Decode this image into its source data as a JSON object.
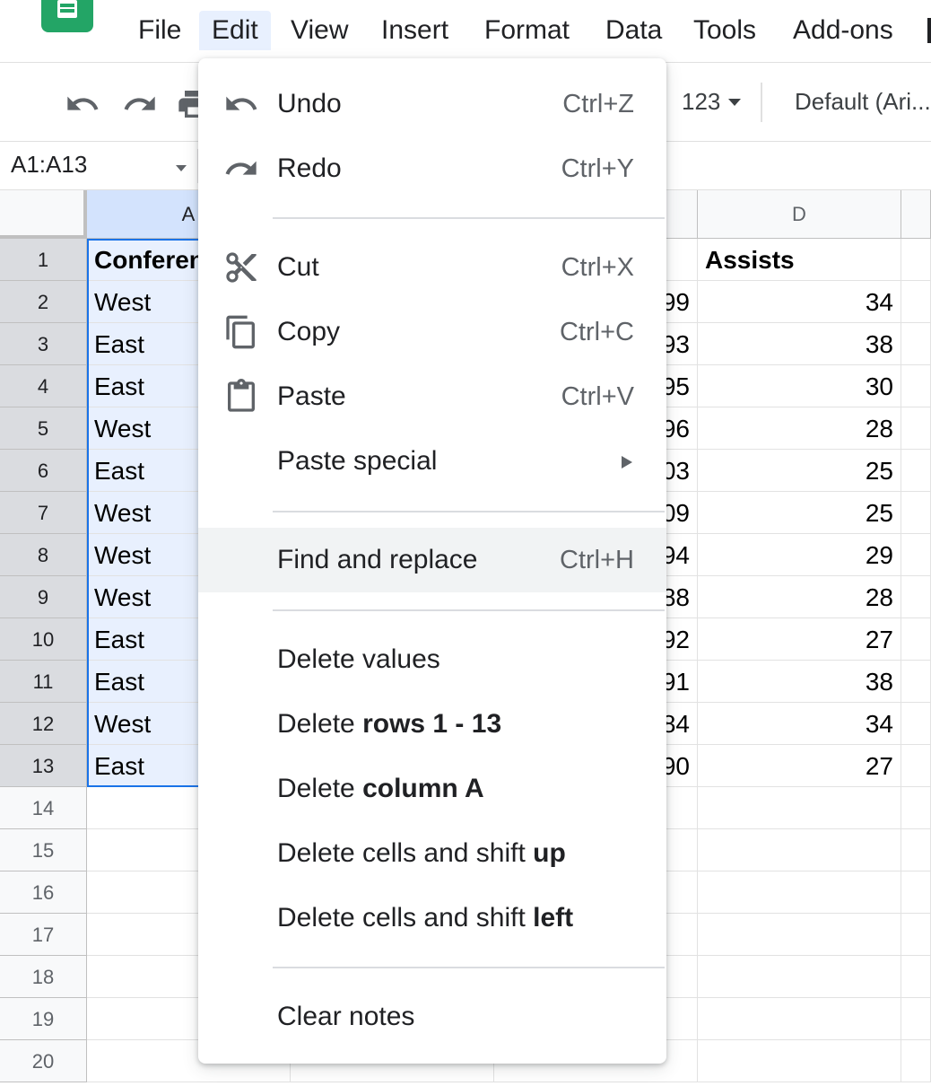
{
  "menubar": {
    "items": [
      "File",
      "Edit",
      "View",
      "Insert",
      "Format",
      "Data",
      "Tools",
      "Add-ons"
    ],
    "active": "Edit"
  },
  "toolbar": {
    "number_format": "123",
    "font": "Default (Ari..."
  },
  "namebox": {
    "value": "A1:A13"
  },
  "columns": [
    "A",
    "D"
  ],
  "rows": [
    "1",
    "2",
    "3",
    "4",
    "5",
    "6",
    "7",
    "8",
    "9",
    "10",
    "11",
    "12",
    "13",
    "14",
    "15",
    "16",
    "17",
    "18",
    "19",
    "20"
  ],
  "cells": {
    "A": [
      "Conferen",
      "West",
      "East",
      "East",
      "West",
      "East",
      "West",
      "West",
      "West",
      "East",
      "East",
      "West",
      "East"
    ],
    "C_partial": [
      "99",
      "93",
      "95",
      "96",
      "03",
      "09",
      "94",
      "88",
      "92",
      "91",
      "84",
      "90"
    ],
    "D": [
      "Assists",
      "34",
      "38",
      "30",
      "28",
      "25",
      "25",
      "29",
      "28",
      "27",
      "38",
      "34",
      "27"
    ]
  },
  "edit_menu": {
    "undo": {
      "label": "Undo",
      "shortcut": "Ctrl+Z",
      "icon": "undo-icon"
    },
    "redo": {
      "label": "Redo",
      "shortcut": "Ctrl+Y",
      "icon": "redo-icon"
    },
    "cut": {
      "label": "Cut",
      "shortcut": "Ctrl+X",
      "icon": "scissors-icon"
    },
    "copy": {
      "label": "Copy",
      "shortcut": "Ctrl+C",
      "icon": "copy-icon"
    },
    "paste": {
      "label": "Paste",
      "shortcut": "Ctrl+V",
      "icon": "clipboard-icon"
    },
    "paste_special": {
      "label": "Paste special"
    },
    "find_replace": {
      "label": "Find and replace",
      "shortcut": "Ctrl+H"
    },
    "delete_values": {
      "label": "Delete values"
    },
    "delete_rows": {
      "prefix": "Delete ",
      "bold": "rows 1 - 13"
    },
    "delete_column": {
      "prefix": "Delete ",
      "bold": "column A"
    },
    "delete_shift_up": {
      "prefix": "Delete cells and shift ",
      "bold": "up"
    },
    "delete_shift_left": {
      "prefix": "Delete cells and shift ",
      "bold": "left"
    },
    "clear_notes": {
      "label": "Clear notes"
    }
  },
  "colors": {
    "accent": "#1a73e8",
    "selection": "#e8f0fe",
    "sheets_green": "#23a566"
  }
}
